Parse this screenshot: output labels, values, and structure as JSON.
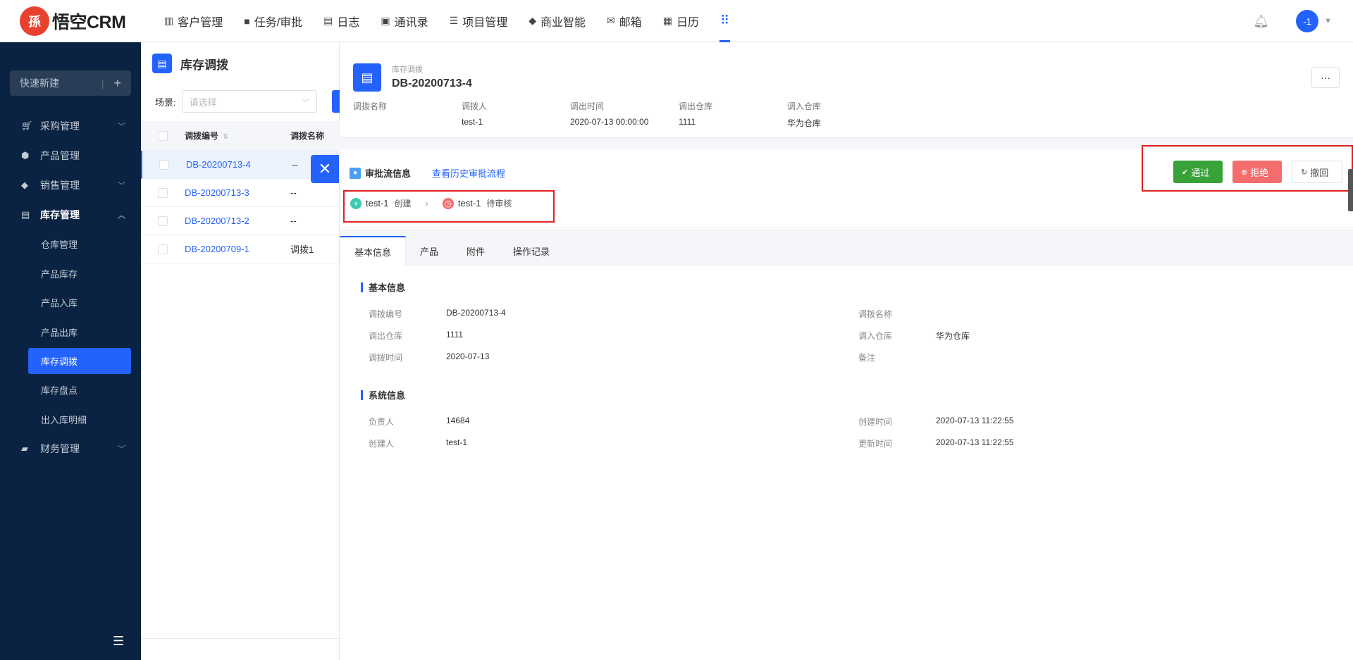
{
  "app": {
    "logo_char": "孫",
    "logo_text": "悟空CRM"
  },
  "topnav": {
    "items": [
      {
        "label": "客户管理",
        "icon": "building-icon"
      },
      {
        "label": "任务/审批",
        "icon": "briefcase-icon"
      },
      {
        "label": "日志",
        "icon": "document-icon"
      },
      {
        "label": "通讯录",
        "icon": "phone-book-icon"
      },
      {
        "label": "项目管理",
        "icon": "list-icon"
      },
      {
        "label": "商业智能",
        "icon": "bi-icon"
      },
      {
        "label": "邮箱",
        "icon": "mail-icon"
      },
      {
        "label": "日历",
        "icon": "calendar-icon"
      }
    ],
    "avatar_text": "-1"
  },
  "sidebar": {
    "quick_new": "快速新建",
    "menu": [
      {
        "label": "采购管理"
      },
      {
        "label": "产品管理"
      },
      {
        "label": "销售管理"
      },
      {
        "label": "库存管理"
      },
      {
        "label": "财务管理"
      }
    ],
    "submenu": [
      "仓库管理",
      "产品库存",
      "产品入库",
      "产品出库",
      "库存调拨",
      "库存盘点",
      "出入库明细"
    ]
  },
  "list": {
    "title": "库存调拨",
    "scene_label": "场景:",
    "scene_placeholder": "请选择",
    "columns": [
      "调拨编号",
      "调拨名称"
    ],
    "rows": [
      {
        "code": "DB-20200713-4",
        "name": "--"
      },
      {
        "code": "DB-20200713-3",
        "name": "--"
      },
      {
        "code": "DB-20200713-2",
        "name": "--"
      },
      {
        "code": "DB-20200709-1",
        "name": "调拨1"
      }
    ]
  },
  "detail": {
    "subtitle": "库存调拨",
    "title": "DB-20200713-4",
    "more": "···",
    "summary": [
      {
        "label": "调拨名称",
        "value": ""
      },
      {
        "label": "调拨人",
        "value": "test-1"
      },
      {
        "label": "调出时间",
        "value": "2020-07-13 00:00:00"
      },
      {
        "label": "调出仓库",
        "value": "1111"
      },
      {
        "label": "调入仓库",
        "value": "华为仓库"
      }
    ],
    "approval": {
      "title": "审批流信息",
      "history_link": "查看历史审批流程",
      "steps": [
        {
          "name": "test-1",
          "state": "创建"
        },
        {
          "name": "test-1",
          "state": "待审核"
        }
      ],
      "buttons": {
        "pass": "通过",
        "reject": "拒绝",
        "revoke": "撤回"
      }
    },
    "tabs": [
      "基本信息",
      "产品",
      "附件",
      "操作记录"
    ],
    "basic": {
      "title": "基本信息",
      "fields": [
        {
          "label": "调拨编号",
          "value": "DB-20200713-4"
        },
        {
          "label": "调拨名称",
          "value": ""
        },
        {
          "label": "调出仓库",
          "value": "1111"
        },
        {
          "label": "调入仓库",
          "value": "华为仓库"
        },
        {
          "label": "调拨时间",
          "value": "2020-07-13"
        },
        {
          "label": "备注",
          "value": ""
        }
      ]
    },
    "system": {
      "title": "系统信息",
      "fields": [
        {
          "label": "负责人",
          "value": "14684"
        },
        {
          "label": "创建时间",
          "value": "2020-07-13 11:22:55"
        },
        {
          "label": "创建人",
          "value": "test-1"
        },
        {
          "label": "更新时间",
          "value": "2020-07-13 11:22:55"
        }
      ]
    }
  }
}
